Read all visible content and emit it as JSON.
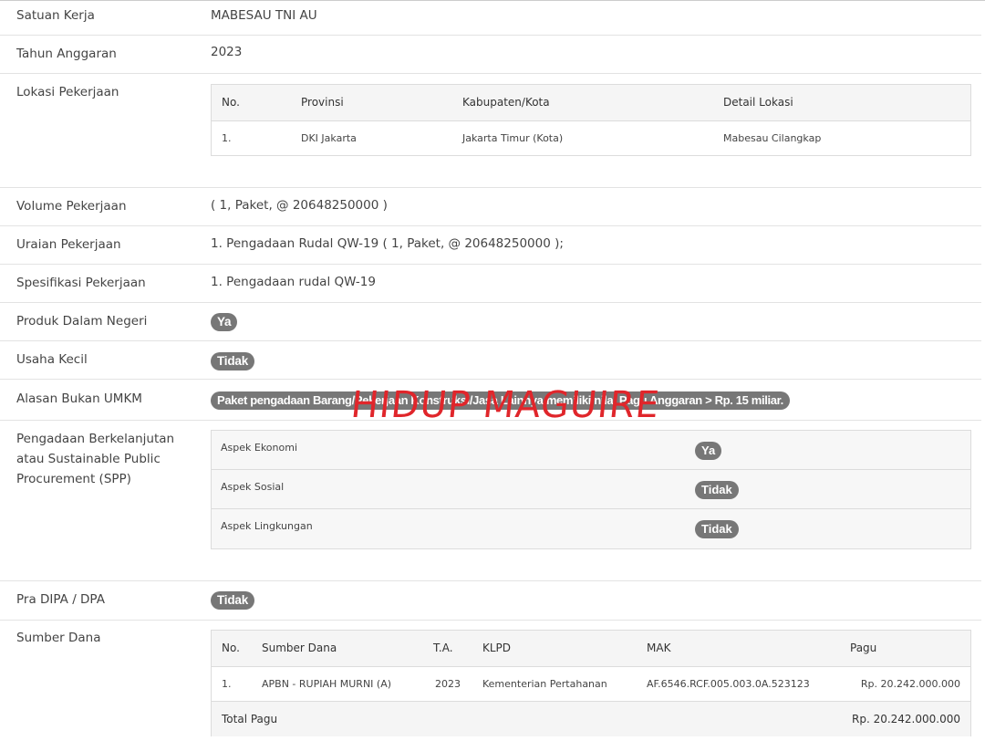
{
  "rows": {
    "satuan_kerja": {
      "label": "Satuan Kerja",
      "value": "MABESAU TNI AU"
    },
    "tahun_anggaran": {
      "label": "Tahun Anggaran",
      "value": "2023"
    },
    "lokasi": {
      "label": "Lokasi Pekerjaan",
      "headers": [
        "No.",
        "Provinsi",
        "Kabupaten/Kota",
        "Detail Lokasi"
      ],
      "rows": [
        [
          "1.",
          "DKI Jakarta",
          "Jakarta Timur (Kota)",
          "Mabesau Cilangkap"
        ]
      ]
    },
    "volume": {
      "label": "Volume Pekerjaan",
      "value": "( 1, Paket, @ 20648250000 )"
    },
    "uraian": {
      "label": "Uraian Pekerjaan",
      "value": "1. Pengadaan Rudal QW-19 ( 1, Paket, @ 20648250000 );"
    },
    "spesifikasi": {
      "label": "Spesifikasi Pekerjaan",
      "value": "1. Pengadaan rudal QW-19"
    },
    "produk": {
      "label": "Produk Dalam Negeri",
      "value": "Ya"
    },
    "usaha_kecil": {
      "label": "Usaha Kecil",
      "value": "Tidak"
    },
    "alasan": {
      "label": "Alasan Bukan UMKM",
      "value": "Paket pengadaan Barang/Pekerjaan Konstruksi/Jasa Lainnya memiliki nilai Pagu Anggaran > Rp. 15 miliar."
    },
    "spp": {
      "label_lines": [
        "Pengadaan Berkelanjutan",
        "atau Sustainable Public",
        "Procurement (SPP)"
      ],
      "aspects": [
        {
          "label": "Aspek Ekonomi",
          "value": "Ya"
        },
        {
          "label": "Aspek Sosial",
          "value": "Tidak"
        },
        {
          "label": "Aspek Lingkungan",
          "value": "Tidak"
        }
      ]
    },
    "pra_dipa": {
      "label": "Pra DIPA / DPA",
      "value": "Tidak"
    },
    "sumber_dana": {
      "label": "Sumber Dana",
      "headers": [
        "No.",
        "Sumber Dana",
        "T.A.",
        "KLPD",
        "MAK",
        "Pagu"
      ],
      "rows": [
        [
          "1.",
          "APBN - RUPIAH MURNI (A)",
          "2023",
          "Kementerian Pertahanan",
          "AF.6546.RCF.005.003.0A.523123",
          "Rp. 20.242.000.000"
        ]
      ],
      "total_label": "Total Pagu",
      "total_value": "Rp. 20.242.000.000"
    }
  },
  "watermark": "HIDUP MAGUIRE"
}
